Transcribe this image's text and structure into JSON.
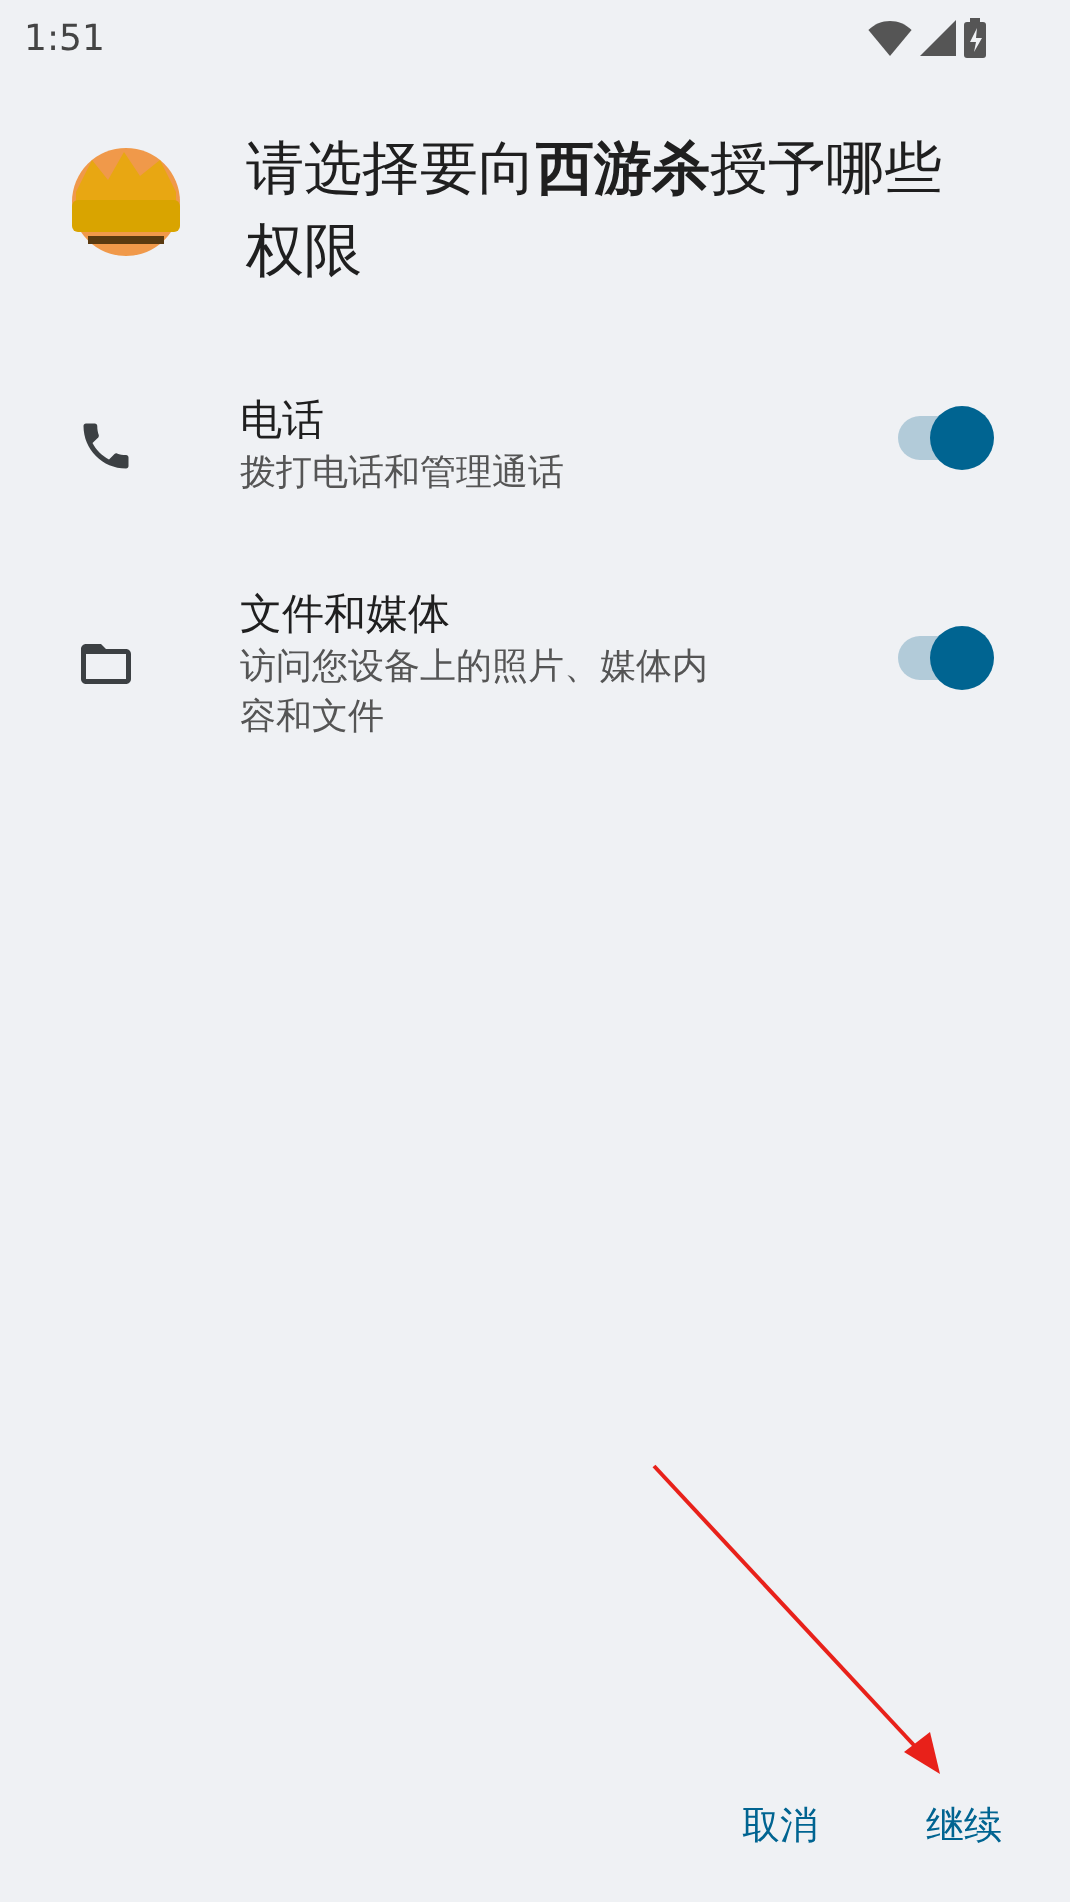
{
  "status_bar": {
    "time": "1:51"
  },
  "header": {
    "title": "请选择要向**西游杀**授予哪些权限"
  },
  "permissions": [
    {
      "kind": "phone",
      "label": "电话",
      "description": "拨打电话和管理通话",
      "on": true
    },
    {
      "kind": "folder",
      "label": "文件和媒体",
      "description": "访问您设备上的照片、媒体内容和文件",
      "on": true
    }
  ],
  "buttons": [
    "取消",
    "继续"
  ]
}
